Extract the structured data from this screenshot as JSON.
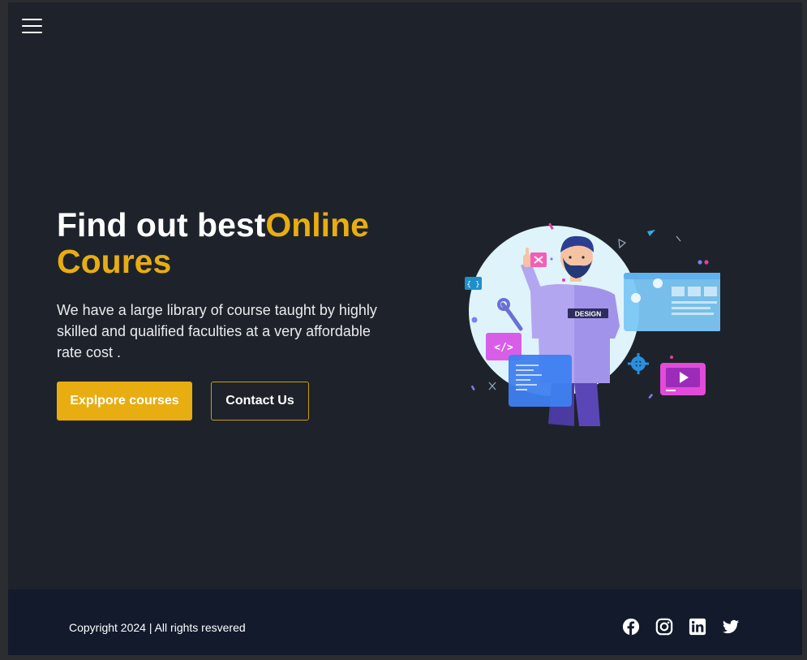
{
  "nav": {
    "menu_icon": "hamburger-menu-icon"
  },
  "hero": {
    "title_main": "Find out best",
    "title_accent_1": "Online",
    "title_accent_2": "Coures",
    "subtitle": "We have a large library of course taught by highly skilled and qualified faculties at a very affordable rate cost .",
    "explore_label": "Explpore courses",
    "contact_label": "Contact Us",
    "illustration_badge": "DESIGN"
  },
  "footer": {
    "copyright": "Copyright 2024 | All rights resvered",
    "socials": [
      "facebook-icon",
      "instagram-icon",
      "linkedin-icon",
      "twitter-icon"
    ]
  },
  "colors": {
    "page_bg": "#1e232b",
    "footer_bg": "#121a2c",
    "accent": "#e8ad11",
    "text": "#ffffff"
  }
}
